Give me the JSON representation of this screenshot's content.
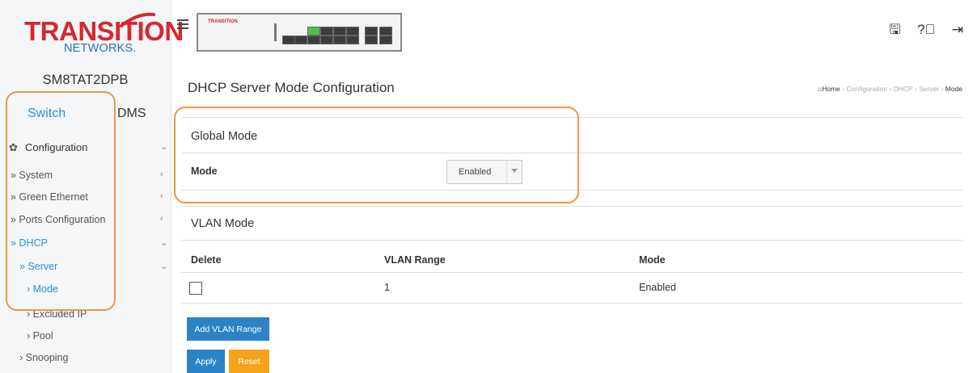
{
  "brand": {
    "name": "TRANSITION",
    "sub": "NETWORKS.",
    "device_label": "TRANSITION"
  },
  "device_name": "SM8TAT2DPB",
  "tabs": [
    {
      "label": "Switch",
      "active": true
    },
    {
      "label": "DMS",
      "active": false
    }
  ],
  "nav": [
    {
      "label": "Configuration",
      "chevron": "⌄"
    },
    {
      "label": "» System",
      "chevron": "‹"
    },
    {
      "label": "» Green Ethernet",
      "chevron": "‹"
    },
    {
      "label": "» Ports Configuration",
      "chevron": "‹"
    },
    {
      "label": "» DHCP",
      "chevron": "⌄"
    },
    {
      "label": "» Server",
      "chevron": "⌄"
    },
    {
      "label": "› Mode",
      "chevron": ""
    },
    {
      "label": "› Excluded IP",
      "chevron": ""
    },
    {
      "label": "› Pool",
      "chevron": ""
    },
    {
      "label": "› Snooping",
      "chevron": ""
    }
  ],
  "top_icons": [
    "save-icon",
    "help-icon",
    "logout-icon"
  ],
  "page_title": "DHCP Server Mode Configuration",
  "breadcrumb": {
    "home": "Home",
    "items": [
      "Configuration",
      "DHCP",
      "Server"
    ],
    "current": "Mode"
  },
  "global_mode": {
    "title": "Global Mode",
    "mode_label": "Mode",
    "mode_value": "Enabled"
  },
  "vlan_mode": {
    "title": "VLAN Mode",
    "headers": [
      "Delete",
      "VLAN Range",
      "Mode"
    ],
    "rows": [
      {
        "delete": false,
        "vlan_range": "1",
        "mode": "Enabled"
      }
    ]
  },
  "buttons": {
    "add_vlan_range": "Add VLAN Range",
    "apply": "Apply",
    "reset": "Reset"
  },
  "colors": {
    "accent": "#2b8fd8",
    "primary_button": "#2b83c6",
    "reset_button": "#f4a21a",
    "highlight": "#f29440"
  }
}
